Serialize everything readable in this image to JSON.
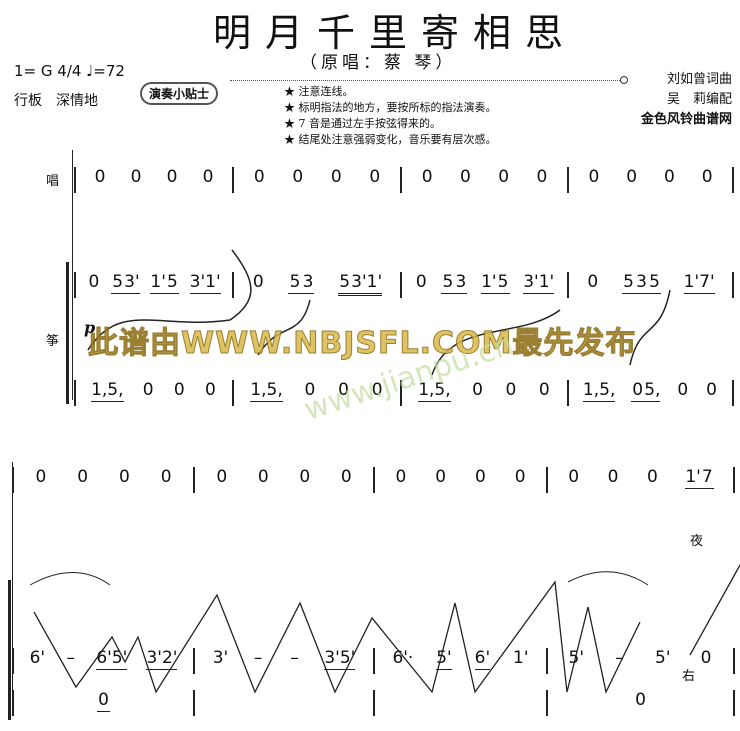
{
  "header": {
    "title": "明月千里寄相思",
    "subtitle": "（原唱：蔡 琴）",
    "key": "1= G  4/4  ♩=72",
    "tempo": "行板　深情地",
    "tips_badge": "演奏小贴士",
    "tips": [
      "★ 注意连线。",
      "★ 标明指法的地方，要按所标的指法演奏。",
      "★ 7 音是通过左手按弦得来的。",
      "★ 结尾处注意强弱变化，音乐要有层次感。"
    ],
    "credits": [
      "刘如曾词曲",
      "吴　莉编配",
      "金色风铃曲谱网"
    ]
  },
  "labels": {
    "voice": "唱",
    "zheng": "筝",
    "dynamic": "p",
    "lyric": "夜",
    "hand": "右"
  },
  "watermark": {
    "main": "此谱由WWW.NBJSFL.COM最先发布",
    "sub": "www.jianpu.cn"
  },
  "system1": {
    "voice": [
      [
        "0",
        "0",
        "0",
        "0"
      ],
      [
        "0",
        "0",
        "0",
        "0"
      ],
      [
        "0",
        "0",
        "0",
        "0"
      ],
      [
        "0",
        "0",
        "0",
        "0"
      ]
    ],
    "zheng_upper": [
      [
        "0",
        [
          "5",
          "3'"
        ],
        [
          "1'",
          "5"
        ],
        [
          "3'",
          "1'"
        ]
      ],
      [
        "0",
        [
          "5",
          "3"
        ],
        [
          [
            "5",
            "3'",
            "1'"
          ]
        ]
      ],
      [
        "0",
        [
          "5",
          "3"
        ],
        [
          "1'",
          "5"
        ],
        [
          "3'",
          "1'"
        ]
      ],
      [
        "0",
        [
          "5",
          "3",
          "5"
        ],
        [
          "1'",
          "7'"
        ]
      ]
    ],
    "zheng_lower": [
      [
        [
          "1,",
          "5,"
        ],
        "0",
        "0",
        "0"
      ],
      [
        [
          "1,",
          "5,"
        ],
        "0",
        "0",
        "0"
      ],
      [
        [
          "1,",
          "5,"
        ],
        "0",
        "0",
        "0"
      ],
      [
        [
          "1,",
          "5,"
        ],
        [
          "0",
          "5,"
        ],
        "0",
        "0"
      ]
    ]
  },
  "system2": {
    "voice": [
      [
        "0",
        "0",
        "0",
        "0"
      ],
      [
        "0",
        "0",
        "0",
        "0"
      ],
      [
        "0",
        "0",
        "0",
        "0"
      ],
      [
        "0",
        "0",
        "0",
        [
          "1'",
          "7"
        ]
      ]
    ],
    "zheng_upper": [
      [
        "6'",
        "–",
        [
          "6'",
          "5'"
        ],
        [
          "3'",
          "2'"
        ]
      ],
      [
        "3'",
        "–",
        "–",
        [
          "3'",
          "5'"
        ]
      ],
      [
        "6'·",
        [
          "5'"
        ],
        [
          "6'"
        ],
        "1'"
      ],
      [
        "5'",
        "–",
        "5'",
        "0"
      ]
    ],
    "zheng_lower": [
      [
        [
          "0"
        ]
      ],
      [],
      [],
      [
        "0"
      ]
    ]
  }
}
